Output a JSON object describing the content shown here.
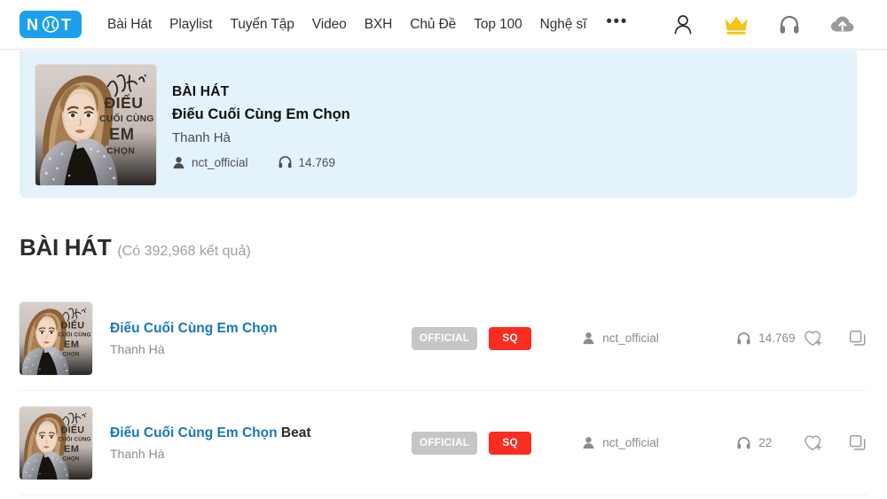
{
  "header": {
    "logo_text": "NCT",
    "nav": [
      {
        "label": "Bài Hát"
      },
      {
        "label": "Playlist"
      },
      {
        "label": "Tuyển Tập"
      },
      {
        "label": "Video"
      },
      {
        "label": "BXH"
      },
      {
        "label": "Chủ Đề"
      },
      {
        "label": "Top 100"
      },
      {
        "label": "Nghệ sĩ"
      }
    ],
    "more_label": "•••",
    "icons": [
      {
        "name": "user-icon"
      },
      {
        "name": "crown-icon",
        "color": "#f9c111"
      },
      {
        "name": "headphones-icon"
      },
      {
        "name": "cloud-upload-icon"
      }
    ]
  },
  "featured": {
    "kind": "BÀI HÁT",
    "title": "Điếu Cuối Cùng Em Chọn",
    "artist": "Thanh Hà",
    "uploader": "nct_official",
    "plays": "14.769",
    "bg_color": "#e4f2fb"
  },
  "section": {
    "title": "BÀI HÁT",
    "count_label": "(Có 392,968 kết quả)"
  },
  "songs": [
    {
      "title": "Điếu Cuối Cùng Em Chọn",
      "title_suffix": "",
      "artist": "Thanh Hà",
      "badge_official": "OFFICIAL",
      "badge_quality": "SQ",
      "uploader": "nct_official",
      "plays": "14.769"
    },
    {
      "title": "Điếu Cuối Cùng Em Chọn",
      "title_suffix": " Beat",
      "artist": "Thanh Hà",
      "badge_official": "OFFICIAL",
      "badge_quality": "SQ",
      "uploader": "nct_official",
      "plays": "22"
    }
  ],
  "colors": {
    "accent": "#1ca0ee",
    "link": "#1878b9",
    "badge_red": "#fa2d20",
    "badge_gray": "#c6c6c6",
    "crown": "#f9c111"
  }
}
